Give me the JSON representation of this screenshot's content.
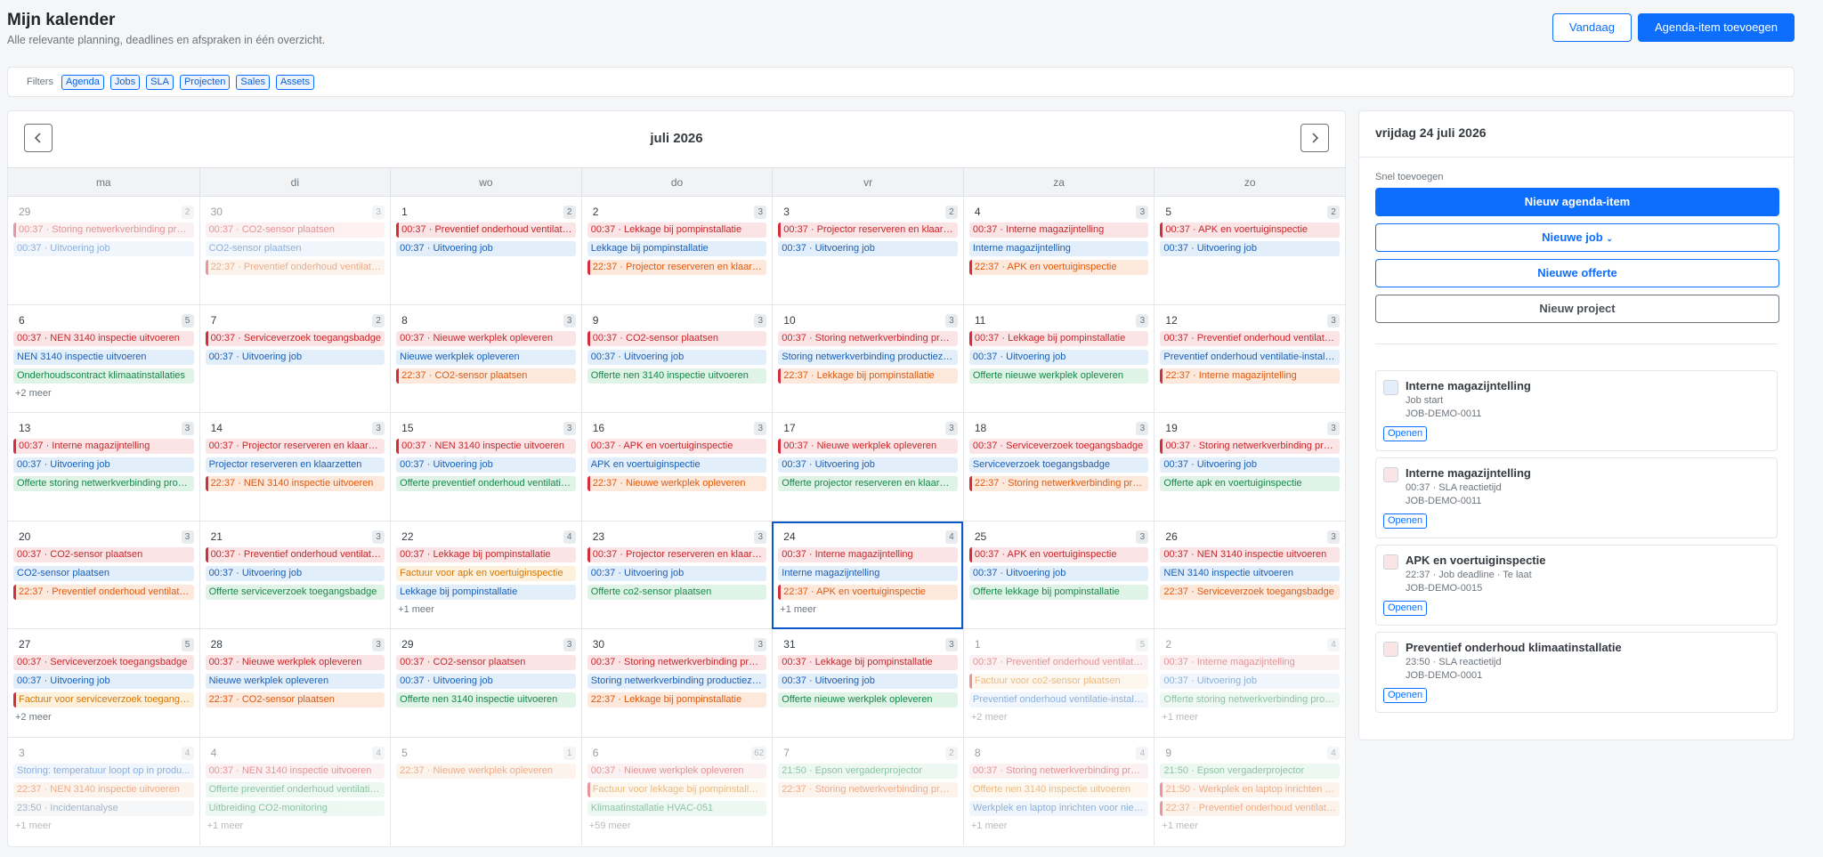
{
  "header": {
    "title": "Mijn kalender",
    "subtitle": "Alle relevante planning, deadlines en afspraken in één overzicht.",
    "today_label": "Vandaag",
    "add_label": "Agenda-item toevoegen"
  },
  "filters": {
    "label": "Filters",
    "chips": [
      "Agenda",
      "Jobs",
      "SLA",
      "Projecten",
      "Sales",
      "Assets"
    ]
  },
  "calendar": {
    "month": "juli 2026",
    "prev_icon": "chevron-left-icon",
    "next_icon": "chevron-right-icon",
    "weekdays": [
      "ma",
      "di",
      "wo",
      "do",
      "vr",
      "za",
      "zo"
    ],
    "days": [
      {
        "num": "29",
        "count": "2",
        "out": true,
        "events": [
          {
            "t": "00:37 · Storing netwerkverbinding prod...",
            "c": "red br"
          },
          {
            "t": "00:37 · Uitvoering job",
            "c": "blue"
          }
        ]
      },
      {
        "num": "30",
        "count": "3",
        "out": true,
        "events": [
          {
            "t": "00:37 · CO2-sensor plaatsen",
            "c": "red"
          },
          {
            "t": "CO2-sensor plaatsen",
            "c": "blue"
          },
          {
            "t": "22:37 · Preventief onderhoud ventilatie-...",
            "c": "orange br"
          }
        ]
      },
      {
        "num": "1",
        "count": "2",
        "events": [
          {
            "t": "00:37 · Preventief onderhoud ventilatie-...",
            "c": "red br"
          },
          {
            "t": "00:37 · Uitvoering job",
            "c": "blue"
          }
        ]
      },
      {
        "num": "2",
        "count": "3",
        "events": [
          {
            "t": "00:37 · Lekkage bij pompinstallatie",
            "c": "red"
          },
          {
            "t": "Lekkage bij pompinstallatie",
            "c": "blue"
          },
          {
            "t": "22:37 · Projector reserveren en klaarzett...",
            "c": "orange br"
          }
        ]
      },
      {
        "num": "3",
        "count": "2",
        "events": [
          {
            "t": "00:37 · Projector reserveren en klaarzett...",
            "c": "red br"
          },
          {
            "t": "00:37 · Uitvoering job",
            "c": "blue"
          }
        ]
      },
      {
        "num": "4",
        "count": "3",
        "events": [
          {
            "t": "00:37 · Interne magazijntelling",
            "c": "red"
          },
          {
            "t": "Interne magazijntelling",
            "c": "blue"
          },
          {
            "t": "22:37 · APK en voertuiginspectie",
            "c": "orange br"
          }
        ]
      },
      {
        "num": "5",
        "count": "2",
        "events": [
          {
            "t": "00:37 · APK en voertuiginspectie",
            "c": "red br"
          },
          {
            "t": "00:37 · Uitvoering job",
            "c": "blue"
          }
        ]
      },
      {
        "num": "6",
        "count": "5",
        "events": [
          {
            "t": "00:37 · NEN 3140 inspectie uitvoeren",
            "c": "red"
          },
          {
            "t": "NEN 3140 inspectie uitvoeren",
            "c": "blue"
          },
          {
            "t": "Onderhoudscontract klimaatinstallaties",
            "c": "green"
          }
        ],
        "more": "+2 meer"
      },
      {
        "num": "7",
        "count": "2",
        "events": [
          {
            "t": "00:37 · Serviceverzoek toegangsbadge",
            "c": "red br"
          },
          {
            "t": "00:37 · Uitvoering job",
            "c": "blue"
          }
        ]
      },
      {
        "num": "8",
        "count": "3",
        "events": [
          {
            "t": "00:37 · Nieuwe werkplek opleveren",
            "c": "red"
          },
          {
            "t": "Nieuwe werkplek opleveren",
            "c": "blue"
          },
          {
            "t": "22:37 · CO2-sensor plaatsen",
            "c": "orange br"
          }
        ]
      },
      {
        "num": "9",
        "count": "3",
        "events": [
          {
            "t": "00:37 · CO2-sensor plaatsen",
            "c": "red br"
          },
          {
            "t": "00:37 · Uitvoering job",
            "c": "blue"
          },
          {
            "t": "Offerte nen 3140 inspectie uitvoeren",
            "c": "green"
          }
        ]
      },
      {
        "num": "10",
        "count": "3",
        "events": [
          {
            "t": "00:37 · Storing netwerkverbinding prod...",
            "c": "red"
          },
          {
            "t": "Storing netwerkverbinding productiezo...",
            "c": "blue"
          },
          {
            "t": "22:37 · Lekkage bij pompinstallatie",
            "c": "orange br"
          }
        ]
      },
      {
        "num": "11",
        "count": "3",
        "events": [
          {
            "t": "00:37 · Lekkage bij pompinstallatie",
            "c": "red br"
          },
          {
            "t": "00:37 · Uitvoering job",
            "c": "blue"
          },
          {
            "t": "Offerte nieuwe werkplek opleveren",
            "c": "green"
          }
        ]
      },
      {
        "num": "12",
        "count": "3",
        "events": [
          {
            "t": "00:37 · Preventief onderhoud ventilatie-...",
            "c": "red"
          },
          {
            "t": "Preventief onderhoud ventilatie-installa...",
            "c": "blue"
          },
          {
            "t": "22:37 · Interne magazijntelling",
            "c": "orange br"
          }
        ]
      },
      {
        "num": "13",
        "count": "3",
        "events": [
          {
            "t": "00:37 · Interne magazijntelling",
            "c": "red br"
          },
          {
            "t": "00:37 · Uitvoering job",
            "c": "blue"
          },
          {
            "t": "Offerte storing netwerkverbinding prod...",
            "c": "green"
          }
        ]
      },
      {
        "num": "14",
        "count": "3",
        "events": [
          {
            "t": "00:37 · Projector reserveren en klaarzett...",
            "c": "red"
          },
          {
            "t": "Projector reserveren en klaarzetten",
            "c": "blue"
          },
          {
            "t": "22:37 · NEN 3140 inspectie uitvoeren",
            "c": "orange br"
          }
        ]
      },
      {
        "num": "15",
        "count": "3",
        "events": [
          {
            "t": "00:37 · NEN 3140 inspectie uitvoeren",
            "c": "red br"
          },
          {
            "t": "00:37 · Uitvoering job",
            "c": "blue"
          },
          {
            "t": "Offerte preventief onderhoud ventilatie...",
            "c": "green"
          }
        ]
      },
      {
        "num": "16",
        "count": "3",
        "events": [
          {
            "t": "00:37 · APK en voertuiginspectie",
            "c": "red"
          },
          {
            "t": "APK en voertuiginspectie",
            "c": "blue"
          },
          {
            "t": "22:37 · Nieuwe werkplek opleveren",
            "c": "orange br"
          }
        ]
      },
      {
        "num": "17",
        "count": "3",
        "events": [
          {
            "t": "00:37 · Nieuwe werkplek opleveren",
            "c": "red br"
          },
          {
            "t": "00:37 · Uitvoering job",
            "c": "blue"
          },
          {
            "t": "Offerte projector reserveren en klaarzet...",
            "c": "green"
          }
        ]
      },
      {
        "num": "18",
        "count": "3",
        "events": [
          {
            "t": "00:37 · Serviceverzoek toegangsbadge",
            "c": "red"
          },
          {
            "t": "Serviceverzoek toegangsbadge",
            "c": "blue"
          },
          {
            "t": "22:37 · Storing netwerkverbinding prod...",
            "c": "orange br"
          }
        ]
      },
      {
        "num": "19",
        "count": "3",
        "events": [
          {
            "t": "00:37 · Storing netwerkverbinding prod...",
            "c": "red br"
          },
          {
            "t": "00:37 · Uitvoering job",
            "c": "blue"
          },
          {
            "t": "Offerte apk en voertuiginspectie",
            "c": "green"
          }
        ]
      },
      {
        "num": "20",
        "count": "3",
        "events": [
          {
            "t": "00:37 · CO2-sensor plaatsen",
            "c": "red"
          },
          {
            "t": "CO2-sensor plaatsen",
            "c": "blue"
          },
          {
            "t": "22:37 · Preventief onderhoud ventilatie-...",
            "c": "orange br"
          }
        ]
      },
      {
        "num": "21",
        "count": "3",
        "events": [
          {
            "t": "00:37 · Preventief onderhoud ventilatie-...",
            "c": "red br"
          },
          {
            "t": "00:37 · Uitvoering job",
            "c": "blue"
          },
          {
            "t": "Offerte serviceverzoek toegangsbadge",
            "c": "green"
          }
        ]
      },
      {
        "num": "22",
        "count": "4",
        "events": [
          {
            "t": "00:37 · Lekkage bij pompinstallatie",
            "c": "red"
          },
          {
            "t": "Factuur voor apk en voertuiginspectie",
            "c": "amber"
          },
          {
            "t": "Lekkage bij pompinstallatie",
            "c": "blue"
          }
        ],
        "more": "+1 meer"
      },
      {
        "num": "23",
        "count": "3",
        "events": [
          {
            "t": "00:37 · Projector reserveren en klaarzett...",
            "c": "red br"
          },
          {
            "t": "00:37 · Uitvoering job",
            "c": "blue"
          },
          {
            "t": "Offerte co2-sensor plaatsen",
            "c": "green"
          }
        ]
      },
      {
        "num": "24",
        "count": "4",
        "sel": true,
        "events": [
          {
            "t": "00:37 · Interne magazijntelling",
            "c": "red"
          },
          {
            "t": "Interne magazijntelling",
            "c": "blue"
          },
          {
            "t": "22:37 · APK en voertuiginspectie",
            "c": "orange br"
          }
        ],
        "more": "+1 meer"
      },
      {
        "num": "25",
        "count": "3",
        "events": [
          {
            "t": "00:37 · APK en voertuiginspectie",
            "c": "red br"
          },
          {
            "t": "00:37 · Uitvoering job",
            "c": "blue"
          },
          {
            "t": "Offerte lekkage bij pompinstallatie",
            "c": "green"
          }
        ]
      },
      {
        "num": "26",
        "count": "3",
        "events": [
          {
            "t": "00:37 · NEN 3140 inspectie uitvoeren",
            "c": "red"
          },
          {
            "t": "NEN 3140 inspectie uitvoeren",
            "c": "blue"
          },
          {
            "t": "22:37 · Serviceverzoek toegangsbadge",
            "c": "orange"
          }
        ]
      },
      {
        "num": "27",
        "count": "5",
        "events": [
          {
            "t": "00:37 · Serviceverzoek toegangsbadge",
            "c": "red"
          },
          {
            "t": "00:37 · Uitvoering job",
            "c": "blue"
          },
          {
            "t": "Factuur voor serviceverzoek toegangsb...",
            "c": "amber br"
          }
        ],
        "more": "+2 meer"
      },
      {
        "num": "28",
        "count": "3",
        "events": [
          {
            "t": "00:37 · Nieuwe werkplek opleveren",
            "c": "red"
          },
          {
            "t": "Nieuwe werkplek opleveren",
            "c": "blue"
          },
          {
            "t": "22:37 · CO2-sensor plaatsen",
            "c": "orange"
          }
        ]
      },
      {
        "num": "29",
        "count": "3",
        "events": [
          {
            "t": "00:37 · CO2-sensor plaatsen",
            "c": "red"
          },
          {
            "t": "00:37 · Uitvoering job",
            "c": "blue"
          },
          {
            "t": "Offerte nen 3140 inspectie uitvoeren",
            "c": "green"
          }
        ]
      },
      {
        "num": "30",
        "count": "3",
        "events": [
          {
            "t": "00:37 · Storing netwerkverbinding prod...",
            "c": "red"
          },
          {
            "t": "Storing netwerkverbinding productiezo...",
            "c": "blue"
          },
          {
            "t": "22:37 · Lekkage bij pompinstallatie",
            "c": "orange"
          }
        ]
      },
      {
        "num": "31",
        "count": "3",
        "events": [
          {
            "t": "00:37 · Lekkage bij pompinstallatie",
            "c": "red"
          },
          {
            "t": "00:37 · Uitvoering job",
            "c": "blue"
          },
          {
            "t": "Offerte nieuwe werkplek opleveren",
            "c": "green"
          }
        ]
      },
      {
        "num": "1",
        "count": "5",
        "out": true,
        "events": [
          {
            "t": "00:37 · Preventief onderhoud ventilatie-...",
            "c": "red"
          },
          {
            "t": "Factuur voor co2-sensor plaatsen",
            "c": "amber br"
          },
          {
            "t": "Preventief onderhoud ventilatie-installa...",
            "c": "blue"
          }
        ],
        "more": "+2 meer"
      },
      {
        "num": "2",
        "count": "4",
        "out": true,
        "events": [
          {
            "t": "00:37 · Interne magazijntelling",
            "c": "red"
          },
          {
            "t": "00:37 · Uitvoering job",
            "c": "blue"
          },
          {
            "t": "Offerte storing netwerkverbinding prod...",
            "c": "green"
          }
        ],
        "more": "+1 meer"
      },
      {
        "num": "3",
        "count": "4",
        "out": true,
        "events": [
          {
            "t": "Storing: temperatuur loopt op in produ...",
            "c": "blue"
          },
          {
            "t": "22:37 · NEN 3140 inspectie uitvoeren",
            "c": "orange"
          },
          {
            "t": "23:50 · Incidentanalyse",
            "c": "gray"
          }
        ],
        "more": "+1 meer"
      },
      {
        "num": "4",
        "count": "4",
        "out": true,
        "events": [
          {
            "t": "00:37 · NEN 3140 inspectie uitvoeren",
            "c": "red"
          },
          {
            "t": "Offerte preventief onderhoud ventilatie...",
            "c": "green"
          },
          {
            "t": "Uitbreiding CO2-monitoring",
            "c": "green"
          }
        ],
        "more": "+1 meer"
      },
      {
        "num": "5",
        "count": "1",
        "out": true,
        "events": [
          {
            "t": "22:37 · Nieuwe werkplek opleveren",
            "c": "orange"
          }
        ]
      },
      {
        "num": "6",
        "count": "62",
        "out": true,
        "events": [
          {
            "t": "00:37 · Nieuwe werkplek opleveren",
            "c": "red"
          },
          {
            "t": "Factuur voor lekkage bij pompinstallatie",
            "c": "amber br"
          },
          {
            "t": "Klimaatinstallatie HVAC-051",
            "c": "green"
          }
        ],
        "more": "+59 meer"
      },
      {
        "num": "7",
        "count": "2",
        "out": true,
        "events": [
          {
            "t": "21:50 · Epson vergaderprojector",
            "c": "green"
          },
          {
            "t": "22:37 · Storing netwerkverbinding prod...",
            "c": "orange"
          }
        ]
      },
      {
        "num": "8",
        "count": "4",
        "out": true,
        "events": [
          {
            "t": "00:37 · Storing netwerkverbinding prod...",
            "c": "red"
          },
          {
            "t": "Offerte nen 3140 inspectie uitvoeren",
            "c": "amber"
          },
          {
            "t": "Werkplek en laptop inrichten voor nieu...",
            "c": "blue"
          }
        ],
        "more": "+1 meer"
      },
      {
        "num": "9",
        "count": "4",
        "out": true,
        "events": [
          {
            "t": "21:50 · Epson vergaderprojector",
            "c": "green"
          },
          {
            "t": "21:50 · Werkplek en laptop inrichten vo...",
            "c": "orange br"
          },
          {
            "t": "22:37 · Preventief onderhoud ventilatie-...",
            "c": "orange br"
          }
        ],
        "more": "+1 meer"
      }
    ]
  },
  "sidebar": {
    "date_title": "vrijdag 24 juli 2026",
    "quick_add_label": "Snel toevoegen",
    "new_agenda": "Nieuw agenda-item",
    "new_job": "Nieuwe job",
    "new_offer": "Nieuwe offerte",
    "new_project": "Nieuw project",
    "open_label": "Openen",
    "items": [
      {
        "title": "Interne magazijntelling",
        "meta1": "Job start",
        "meta2": "JOB-DEMO-0011",
        "color": "blue"
      },
      {
        "title": "Interne magazijntelling",
        "meta1": "00:37 · SLA reactietijd",
        "meta2": "JOB-DEMO-0011",
        "color": "red"
      },
      {
        "title": "APK en voertuiginspectie",
        "meta1": "22:37 · Job deadline · Te laat",
        "meta2": "JOB-DEMO-0015",
        "color": "red"
      },
      {
        "title": "Preventief onderhoud klimaatinstallatie",
        "meta1": "23:50 · SLA reactietijd",
        "meta2": "JOB-DEMO-0001",
        "color": "red"
      }
    ]
  }
}
